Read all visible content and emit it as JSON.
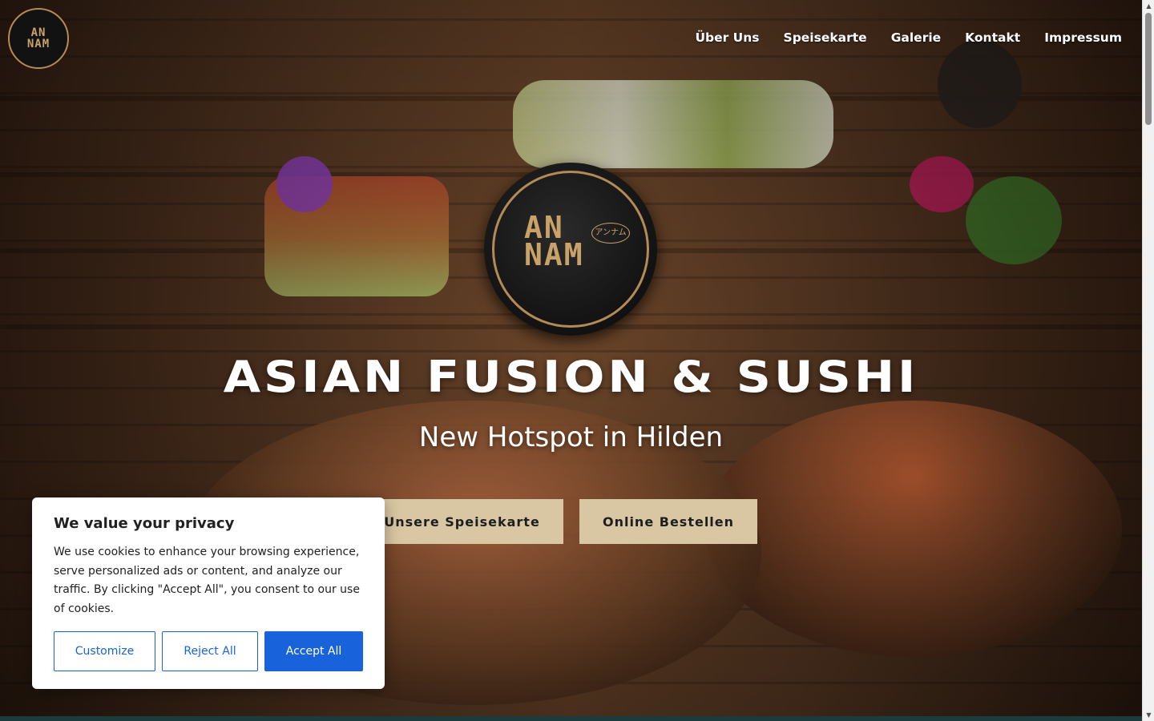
{
  "brand": {
    "logo_text_line1": "AN",
    "logo_text_line2": "NAM",
    "logo_jp": "アンナム"
  },
  "nav": {
    "items": [
      {
        "label": "Über Uns"
      },
      {
        "label": "Speisekarte"
      },
      {
        "label": "Galerie"
      },
      {
        "label": "Kontakt"
      },
      {
        "label": "Impressum"
      }
    ]
  },
  "hero": {
    "headline": "Asian Fusion & Sushi",
    "subheadline": "New Hotspot in Hilden",
    "cta_menu": "Unsere Speisekarte",
    "cta_order": "Online Bestellen"
  },
  "cookie": {
    "title": "We value your privacy",
    "text": "We use cookies to enhance your browsing experience, serve personalized ads or content, and analyze our traffic. By clicking \"Accept All\", you consent to our use of cookies.",
    "customize_label": "Customize",
    "reject_label": "Reject All",
    "accept_label": "Accept All"
  },
  "colors": {
    "accent_gold": "#b48b55",
    "cta_bg": "#d9c7a3",
    "cookie_blue": "#1863dc"
  }
}
